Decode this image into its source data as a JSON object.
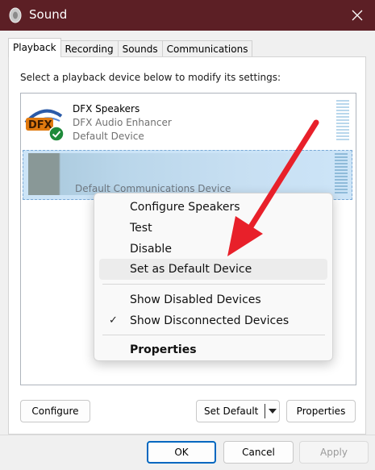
{
  "window": {
    "title": "Sound"
  },
  "tabs": [
    {
      "label": "Playback",
      "active": true
    },
    {
      "label": "Recording",
      "active": false
    },
    {
      "label": "Sounds",
      "active": false
    },
    {
      "label": "Communications",
      "active": false
    }
  ],
  "instruction": "Select a playback device below to modify its settings:",
  "devices": [
    {
      "name": "DFX Speakers",
      "driver": "DFX Audio Enhancer",
      "status": "Default Device",
      "icon": "dfx-logo-icon"
    },
    {
      "status": "Default Communications Device",
      "icon": "blurred-device-icon",
      "selected": true
    }
  ],
  "context_menu": {
    "items": [
      {
        "label": "Configure Speakers"
      },
      {
        "label": "Test"
      },
      {
        "label": "Disable"
      },
      {
        "label": "Set as Default Device",
        "highlighted": true
      },
      {
        "label": "Show Disabled Devices",
        "checked": false
      },
      {
        "label": "Show Disconnected Devices",
        "checked": true
      },
      {
        "label": "Properties",
        "bold": true
      }
    ]
  },
  "buttons": {
    "configure": "Configure",
    "set_default": "Set Default",
    "properties": "Properties",
    "ok": "OK",
    "cancel": "Cancel",
    "apply": "Apply"
  },
  "colors": {
    "titlebar": "#5c1f25",
    "selection": "#cce4f7",
    "arrow": "#e8202a",
    "accent": "#0067c0"
  }
}
